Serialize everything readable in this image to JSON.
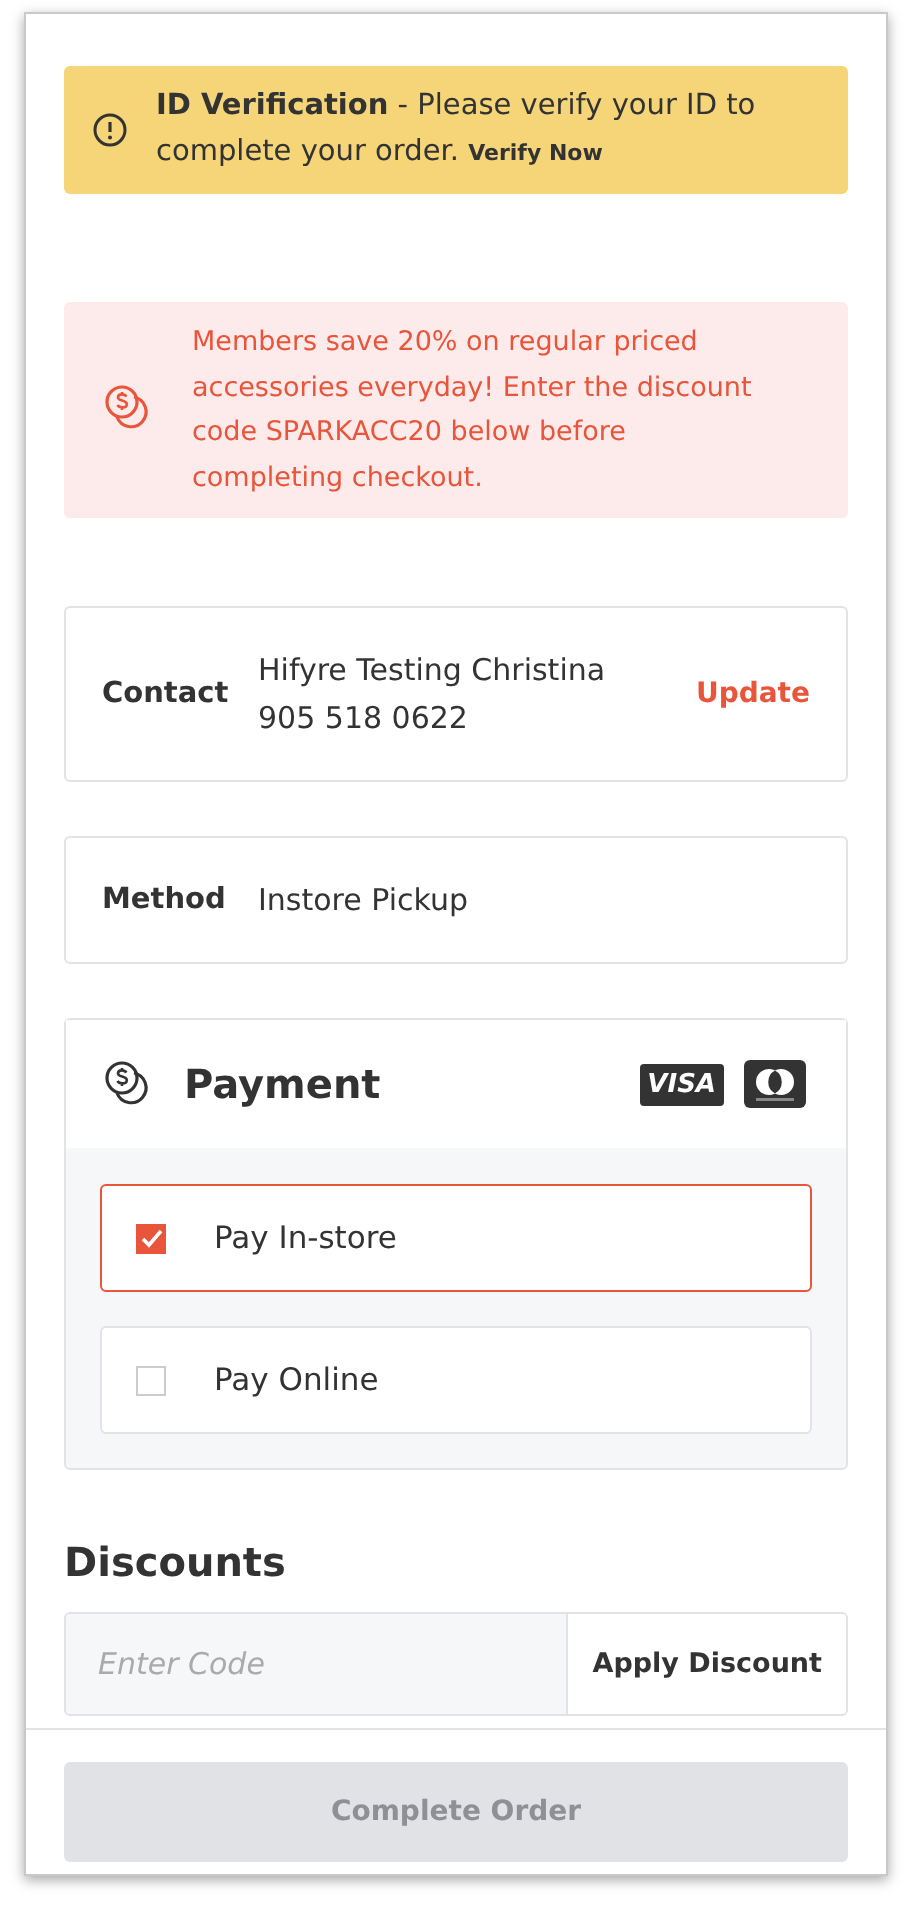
{
  "alert": {
    "message": "**ID Verification** - Please verify your ID to complete your order.",
    "link": "Verify Now"
  },
  "promo": {
    "message": "Members save 20% on regular priced accessories everyday! Enter the discount code SPARKACC20 below before completing checkout."
  },
  "contact": {
    "label": "Contact",
    "name": "Hifyre Testing Christina",
    "phone": "905 518 0622",
    "action": "Update"
  },
  "method": {
    "label": "Method",
    "value": "Instore Pickup"
  },
  "payment": {
    "title": "Payment",
    "card_brand": "VISA",
    "options": [
      {
        "label": "Pay In-store",
        "selected": true
      },
      {
        "label": "Pay Online",
        "selected": false
      }
    ]
  },
  "discounts": {
    "title": "Discounts",
    "placeholder": "Enter Code",
    "button": "Apply Discount"
  },
  "complete_button": {
    "label": "Complete Order",
    "disabled": true
  }
}
